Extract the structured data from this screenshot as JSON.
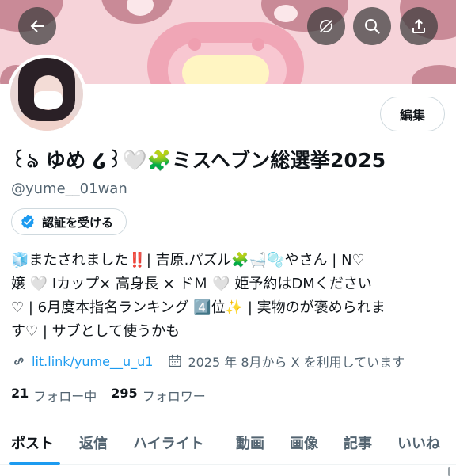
{
  "header": {
    "back_icon": "arrow-left-icon",
    "refresh_icon": "refresh-off-icon",
    "search_icon": "search-icon",
    "share_icon": "share-icon"
  },
  "profile": {
    "edit_label": "編集",
    "display_name": "꒰ঌ ゆめ ໒꒱🤍🧩ミスヘブン総選挙2025",
    "handle": "@yume__01wan",
    "verify_label": "認証を受ける",
    "bio_lines": [
      "🧊またされました‼️| 吉原.パズル🧩🛁🫧やさん | N♡",
      "嬢 🤍 Iカップ× 高身長 × ドＭ 🤍 姫予約はDMください",
      "♡ | 6月度本指名ランキング 4️⃣位✨ | 実物のが褒められま",
      "す♡ | サブとして使うかも"
    ],
    "link_text": "lit.link/yume__u_u1",
    "joined_text": "2025 年 8月から X を利用しています",
    "following_count": "21",
    "following_label": "フォロー中",
    "followers_count": "295",
    "followers_label": "フォロワー"
  },
  "tabs": [
    {
      "label": "ポスト",
      "active": true
    },
    {
      "label": "返信",
      "active": false
    },
    {
      "label": "ハイライト",
      "active": false
    },
    {
      "label": "動画",
      "active": false
    },
    {
      "label": "画像",
      "active": false
    },
    {
      "label": "記事",
      "active": false
    },
    {
      "label": "いいね",
      "active": false
    }
  ],
  "colors": {
    "accent": "#1d9bf0",
    "banner_pink": "#f6d3d9",
    "muted_text": "#536471"
  }
}
